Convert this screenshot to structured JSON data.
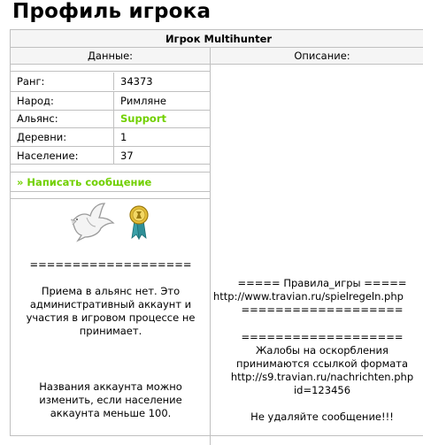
{
  "page_title": "Профиль игрока",
  "header": "Игрок Multihunter",
  "columns": {
    "left": "Данные:",
    "right": "Описание:"
  },
  "stats": [
    {
      "label": "Ранг:",
      "value": "34373"
    },
    {
      "label": "Народ:",
      "value": "Римляне"
    },
    {
      "label": "Альянс:",
      "value": "Support"
    },
    {
      "label": "Деревни:",
      "value": "1"
    },
    {
      "label": "Население:",
      "value": "37"
    }
  ],
  "send_message": "» Написать сообщение",
  "icons": {
    "dove": "dove-icon",
    "medal": "medal-icon"
  },
  "left_description": {
    "divider": "===================",
    "para1": [
      "Приема в альянс нет. Это",
      "административный аккаунт и",
      "участия в игровом процессе не",
      "принимает."
    ],
    "para2": [
      "Названия аккаунта можно",
      "изменить, если население",
      "аккаунта меньше 100."
    ]
  },
  "right_description": {
    "rules_title": "===== Правила_игры =====",
    "rules_url": "http://www.travian.ru/spielregeln.php",
    "divider1": "===================",
    "divider2": "===================",
    "complaint": [
      "Жалобы на оскорбления",
      "принимаются ссылкой формата",
      "http://s9.travian.ru/nachrichten.php",
      "id=123456"
    ],
    "footer": "Не удаляйте сообщение!!!"
  },
  "colors": {
    "alliance": "#71d000",
    "border": "#c0c0c0",
    "header_bg": "#f5f5f5"
  }
}
